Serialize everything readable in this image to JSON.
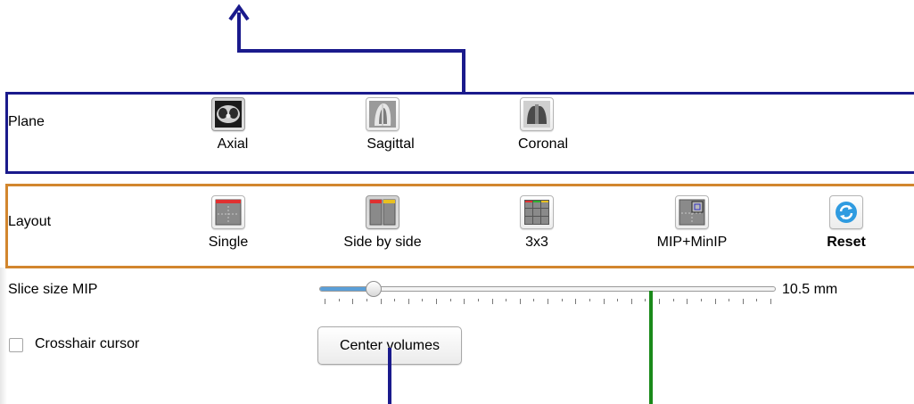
{
  "plane": {
    "label": "Plane",
    "buttons": [
      {
        "label": "Axial",
        "icon": "axial-ct-icon",
        "active": true
      },
      {
        "label": "Sagittal",
        "icon": "sagittal-ct-icon",
        "active": false
      },
      {
        "label": "Coronal",
        "icon": "coronal-ct-icon",
        "active": false
      }
    ]
  },
  "layout": {
    "label": "Layout",
    "buttons": [
      {
        "label": "Single",
        "icon": "single-layout-icon",
        "active": false
      },
      {
        "label": "Side by side",
        "icon": "side-by-side-layout-icon",
        "active": true
      },
      {
        "label": "3x3",
        "icon": "grid-3x3-layout-icon",
        "active": false
      },
      {
        "label": "MIP+MinIP",
        "icon": "mip-minip-layout-icon",
        "active": false
      },
      {
        "label": "Reset",
        "icon": "reset-icon",
        "active": false
      }
    ]
  },
  "slice": {
    "label": "Slice size MIP",
    "value": "10.5 mm",
    "fraction": 0.12
  },
  "crosshair": {
    "label": "Crosshair cursor",
    "checked": false
  },
  "center_button": {
    "label": "Center volumes"
  },
  "colors": {
    "plane_border": "#1a1a8c",
    "layout_border": "#d2862e",
    "arrow_blue": "#1a1a8c",
    "arrow_green": "#1a8a1a",
    "slider_fill": "#5a9fd8"
  }
}
